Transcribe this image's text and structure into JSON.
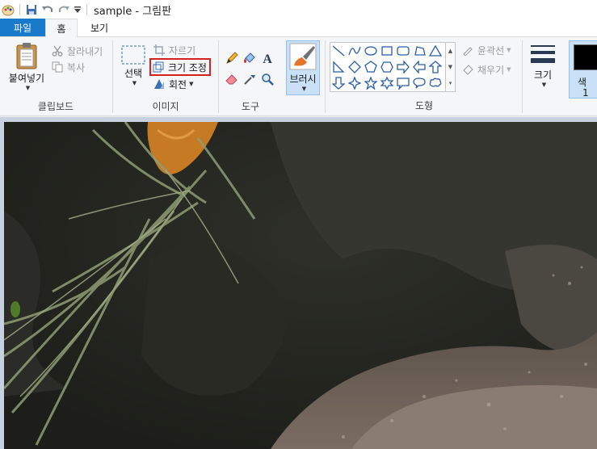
{
  "window": {
    "title": "sample - 그림판"
  },
  "tabs": {
    "file": "파일",
    "home": "홈",
    "view": "보기"
  },
  "clipboard": {
    "paste": "붙여넣기",
    "cut": "잘라내기",
    "copy": "복사",
    "group_label": "클립보드"
  },
  "image": {
    "select": "선택",
    "crop": "자르기",
    "resize": "크기 조정",
    "rotate": "회전",
    "group_label": "이미지"
  },
  "tools": {
    "group_label": "도구"
  },
  "brushes": {
    "label": "브러시"
  },
  "shapes": {
    "outline": "윤곽선",
    "fill": "채우기",
    "group_label": "도형"
  },
  "size": {
    "label": "크기"
  },
  "color1": {
    "label_line1": "색",
    "label_line2": "1",
    "value": "#000000"
  },
  "colors": {
    "accent": "#1979ca",
    "highlight": "#d42020",
    "selected_bg": "#c9e0f7"
  }
}
